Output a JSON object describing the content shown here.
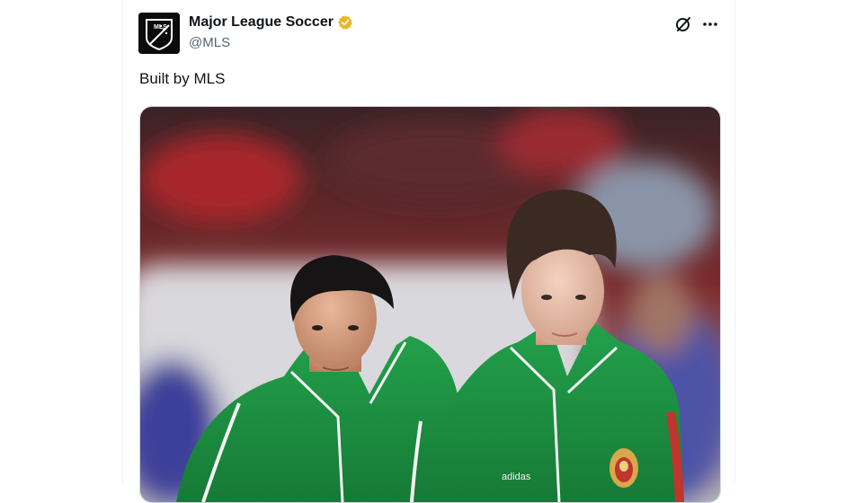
{
  "tweet": {
    "author": {
      "display_name": "Major League Soccer",
      "handle": "@MLS",
      "verified_badge": "gold-verified-badge",
      "avatar_text": "MLS"
    },
    "text": "Built by MLS",
    "media": {
      "kit_brand_text": "adidas"
    }
  },
  "icons": {
    "grok": "grok-icon",
    "more": "more-options-icon"
  },
  "colors": {
    "text_primary": "#0f1419",
    "text_secondary": "#536471",
    "verified_gold": "#e8b829",
    "jersey_green": "#1e8b3f"
  }
}
